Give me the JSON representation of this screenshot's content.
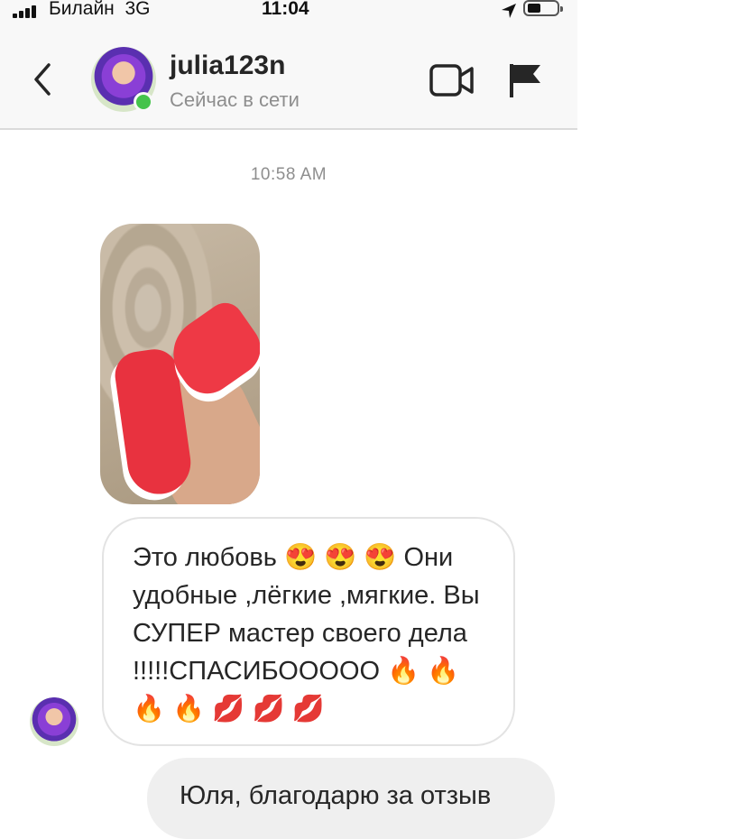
{
  "status_bar": {
    "carrier": "Билайн",
    "network": "3G",
    "time": "11:04"
  },
  "header": {
    "username": "julia123n",
    "presence": "Сейчас в сети",
    "icons": [
      "back-chevron-icon",
      "video-call-icon",
      "report-flag-icon"
    ]
  },
  "chat": {
    "timestamp": "10:58 AM",
    "messages": [
      {
        "from": "julia123n",
        "type": "photo"
      },
      {
        "from": "julia123n",
        "type": "text",
        "text": "Это любовь 😍 😍 😍 Они удобные ,лёгкие ,мягкие. Вы СУПЕР мастер своего дела !!!!!СПАСИБООООО 🔥 🔥 🔥 🔥 💋 💋 💋"
      },
      {
        "from": "me",
        "type": "text",
        "text": "Юля, благодарю за отзыв"
      }
    ]
  },
  "colors": {
    "online": "#44c34b",
    "header_bg": "#f8f8f8",
    "outgoing_bubble": "#efefef"
  }
}
